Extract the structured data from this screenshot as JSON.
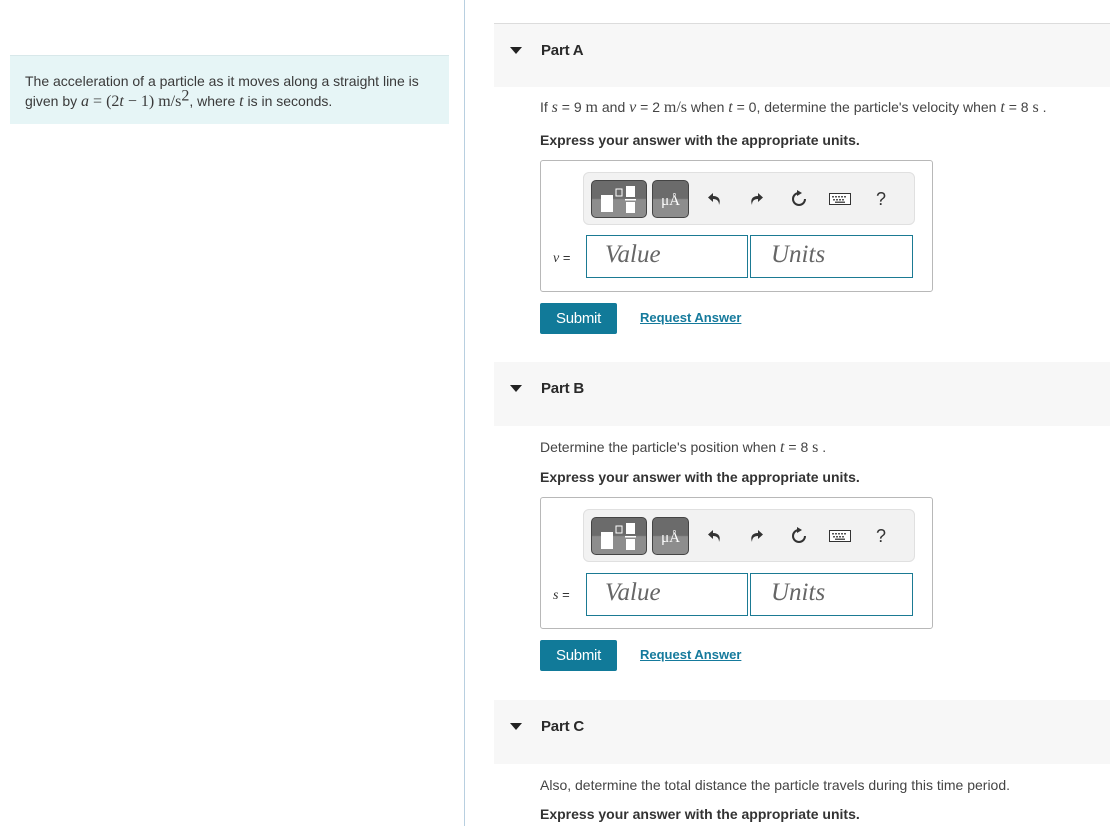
{
  "problem": {
    "text_before": "The acceleration of a particle as it moves along a straight line is given by ",
    "formula_var": "a",
    "formula_eq": " = (2",
    "formula_t": "t",
    "formula_rest": " − 1) m/s",
    "formula_exp": "2",
    "text_mid": ", where ",
    "text_var": "t",
    "text_after": " is in seconds."
  },
  "parts": [
    {
      "title": "Part A",
      "question": {
        "p1": "If ",
        "v1": "s",
        "p2": " = 9 ",
        "u1": "m",
        "p3": " and ",
        "v2": "v",
        "p4": " = 2 ",
        "u2": "m/s",
        "p5": " when ",
        "v3": "t",
        "p6": " = 0, determine the particle's velocity when ",
        "v4": "t",
        "p7": " = 8 ",
        "u3": "s",
        "p8": " ."
      },
      "instruction": "Express your answer with the appropriate units.",
      "variable": "v",
      "equals": " =",
      "value_placeholder": "Value",
      "units_placeholder": "Units",
      "submit_label": "Submit",
      "request_label": "Request Answer"
    },
    {
      "title": "Part B",
      "question": {
        "p1": "Determine the particle's position when ",
        "v1": "t",
        "p2": " = 8 ",
        "u1": "s",
        "p3": " ."
      },
      "instruction": "Express your answer with the appropriate units.",
      "variable": "s",
      "equals": " =",
      "value_placeholder": "Value",
      "units_placeholder": "Units",
      "submit_label": "Submit",
      "request_label": "Request Answer"
    },
    {
      "title": "Part C",
      "question": {
        "p1": "Also, determine the total distance the particle travels during this time period."
      },
      "instruction": "Express your answer with the appropriate units."
    }
  ],
  "toolbar": {
    "units_symbol": "μÅ",
    "help_symbol": "?",
    "icons": [
      "templates-icon",
      "units-icon",
      "undo-icon",
      "redo-icon",
      "reset-icon",
      "keyboard-icon",
      "help-icon"
    ]
  }
}
